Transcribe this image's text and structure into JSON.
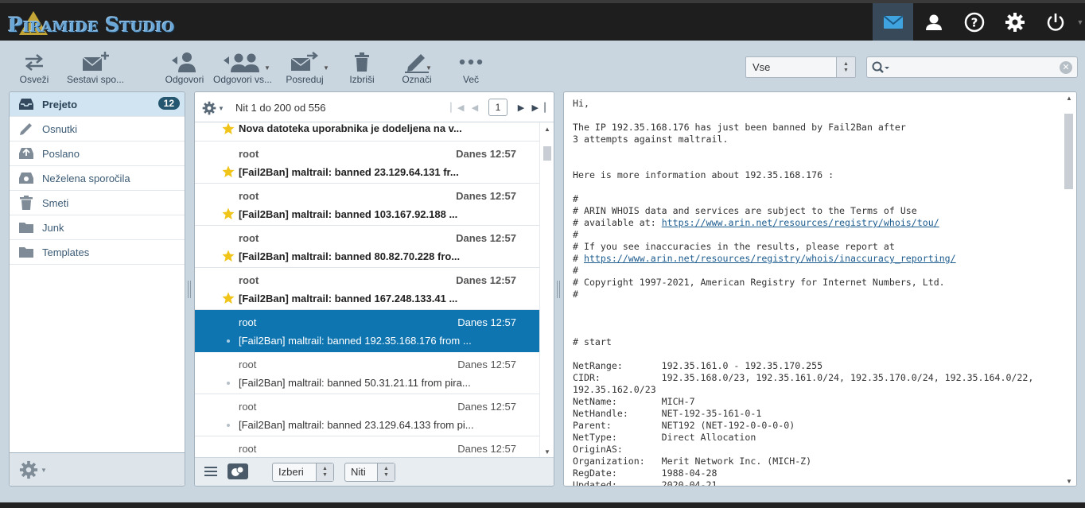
{
  "app": {
    "logo_text": "Piramide Studio"
  },
  "topnav": [
    {
      "name": "mail-icon",
      "active": true
    },
    {
      "name": "contacts-icon",
      "active": false
    },
    {
      "name": "help-icon",
      "active": false
    },
    {
      "name": "settings-icon",
      "active": false
    },
    {
      "name": "logout-icon",
      "active": false
    }
  ],
  "toolbar": {
    "refresh": "Osveži",
    "compose": "Sestavi spo...",
    "reply": "Odgovori",
    "reply_all": "Odgovori vs...",
    "forward": "Posreduj",
    "delete": "Izbriši",
    "mark": "Označi",
    "more": "Več"
  },
  "filter": {
    "value": "Vse"
  },
  "search": {
    "placeholder": "",
    "value": ""
  },
  "folders": [
    {
      "label": "Prejeto",
      "icon": "inbox-icon",
      "selected": true,
      "badge": "12"
    },
    {
      "label": "Osnutki",
      "icon": "drafts-icon"
    },
    {
      "label": "Poslano",
      "icon": "sent-icon"
    },
    {
      "label": "Neželena sporočila",
      "icon": "junk-icon"
    },
    {
      "label": "Smeti",
      "icon": "trash-icon"
    },
    {
      "label": "Junk",
      "icon": "folder-icon"
    },
    {
      "label": "Templates",
      "icon": "folder-icon"
    }
  ],
  "messagelist": {
    "count_text": "Nit 1 do 200 od 556",
    "page": "1",
    "partial_subject": "Nova datoteka uporabnika je dodeljena na v...",
    "messages": [
      {
        "from": "root",
        "date": "Danes 12:57",
        "subject": "[Fail2Ban] maltrail: banned 23.129.64.131 fr...",
        "unread": true,
        "flagged": true
      },
      {
        "from": "root",
        "date": "Danes 12:57",
        "subject": "[Fail2Ban] maltrail: banned 103.167.92.188 ...",
        "unread": true,
        "flagged": true
      },
      {
        "from": "root",
        "date": "Danes 12:57",
        "subject": "[Fail2Ban] maltrail: banned 80.82.70.228 fro...",
        "unread": true,
        "flagged": true
      },
      {
        "from": "root",
        "date": "Danes 12:57",
        "subject": "[Fail2Ban] maltrail: banned 167.248.133.41 ...",
        "unread": true,
        "flagged": true
      },
      {
        "from": "root",
        "date": "Danes 12:57",
        "subject": "[Fail2Ban] maltrail: banned 192.35.168.176 from ...",
        "unread": false,
        "selected": true
      },
      {
        "from": "root",
        "date": "Danes 12:57",
        "subject": "[Fail2Ban] maltrail: banned 50.31.21.11 from pira...",
        "unread": false
      },
      {
        "from": "root",
        "date": "Danes 12:57",
        "subject": "[Fail2Ban] maltrail: banned 23.129.64.133 from pi...",
        "unread": false
      },
      {
        "from": "root",
        "date": "Danes 12:57",
        "subject": "",
        "unread": false
      }
    ],
    "select_label": "Izberi",
    "threads_label": "Niti"
  },
  "preview": {
    "lines": [
      "Hi,",
      "",
      "The IP 192.35.168.176 has just been banned by Fail2Ban after",
      "3 attempts against maltrail.",
      "",
      "",
      "Here is more information about 192.35.168.176 :",
      "",
      "#",
      "# ARIN WHOIS data and services are subject to the Terms of Use",
      "# available at: |https://www.arin.net/resources/registry/whois/tou/",
      "#",
      "# If you see inaccuracies in the results, please report at",
      "# |https://www.arin.net/resources/registry/whois/inaccuracy_reporting/",
      "#",
      "# Copyright 1997-2021, American Registry for Internet Numbers, Ltd.",
      "#",
      "",
      "",
      "",
      "# start",
      "",
      "NetRange:       192.35.161.0 - 192.35.170.255",
      "CIDR:           192.35.168.0/23, 192.35.161.0/24, 192.35.170.0/24, 192.35.164.0/22,",
      "192.35.162.0/23",
      "NetName:        MICH-7",
      "NetHandle:      NET-192-35-161-0-1",
      "Parent:         NET192 (NET-192-0-0-0-0)",
      "NetType:        Direct Allocation",
      "OriginAS:",
      "Organization:   Merit Network Inc. (MICH-Z)",
      "RegDate:        1988-04-28",
      "Updated:        2020-04-21"
    ]
  }
}
